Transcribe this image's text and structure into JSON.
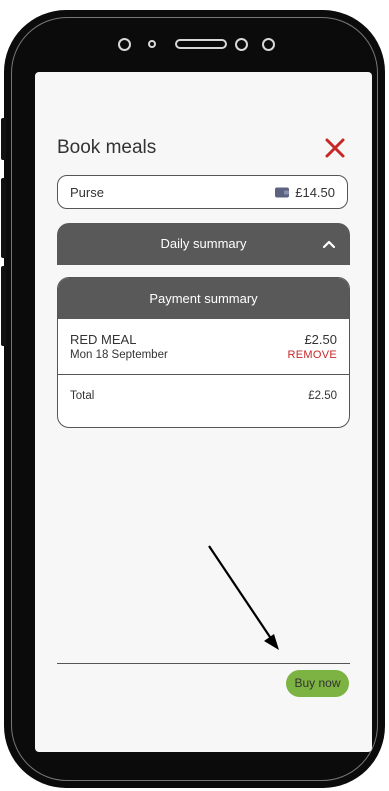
{
  "header": {
    "title": "Book meals"
  },
  "purse": {
    "label": "Purse",
    "balance": "£14.50"
  },
  "daily_summary": {
    "label": "Daily summary"
  },
  "payment_summary": {
    "heading": "Payment summary",
    "items": [
      {
        "name": "RED MEAL",
        "date": "Mon 18 September",
        "price": "£2.50",
        "remove_label": "REMOVE"
      }
    ],
    "total_label": "Total",
    "total_value": "£2.50"
  },
  "footer": {
    "buy_label": "Buy now"
  },
  "colors": {
    "close": "#c62828",
    "remove": "#c62828",
    "section_header": "#595959",
    "buy_button": "#7cb342",
    "wallet_icon": "#5b6380"
  }
}
